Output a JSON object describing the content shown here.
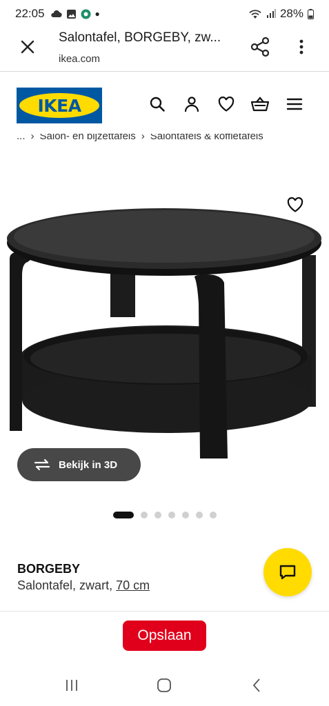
{
  "status": {
    "time": "22:05",
    "battery": "28%",
    "left_icons": [
      "cloud-icon",
      "gallery-icon",
      "app-notification-icon",
      "dot-icon"
    ],
    "right_icons": [
      "wifi-icon",
      "signal-icon",
      "battery-icon"
    ]
  },
  "tab": {
    "title": "Salontafel, BORGEBY, zw...",
    "url": "ikea.com"
  },
  "header": {
    "logo_text": "IKEA",
    "icons": [
      "search-icon",
      "user-icon",
      "heart-icon",
      "basket-icon",
      "menu-icon"
    ]
  },
  "breadcrumb": {
    "items": [
      "...",
      "›",
      "Salon- en bijzettafels",
      "›",
      "Salontafels & koffietafels"
    ]
  },
  "product": {
    "view3d_label": "Bekijk in 3D",
    "carousel_total": 7,
    "carousel_active": 1,
    "name": "BORGEBY",
    "description": "Salontafel, zwart,",
    "size_link": "70 cm"
  },
  "actions": {
    "save_label": "Opslaan"
  },
  "colors": {
    "ikea_blue": "#0058a3",
    "ikea_yellow": "#ffdb00",
    "save_red": "#e0001b",
    "view3d_bg": "#484848"
  }
}
